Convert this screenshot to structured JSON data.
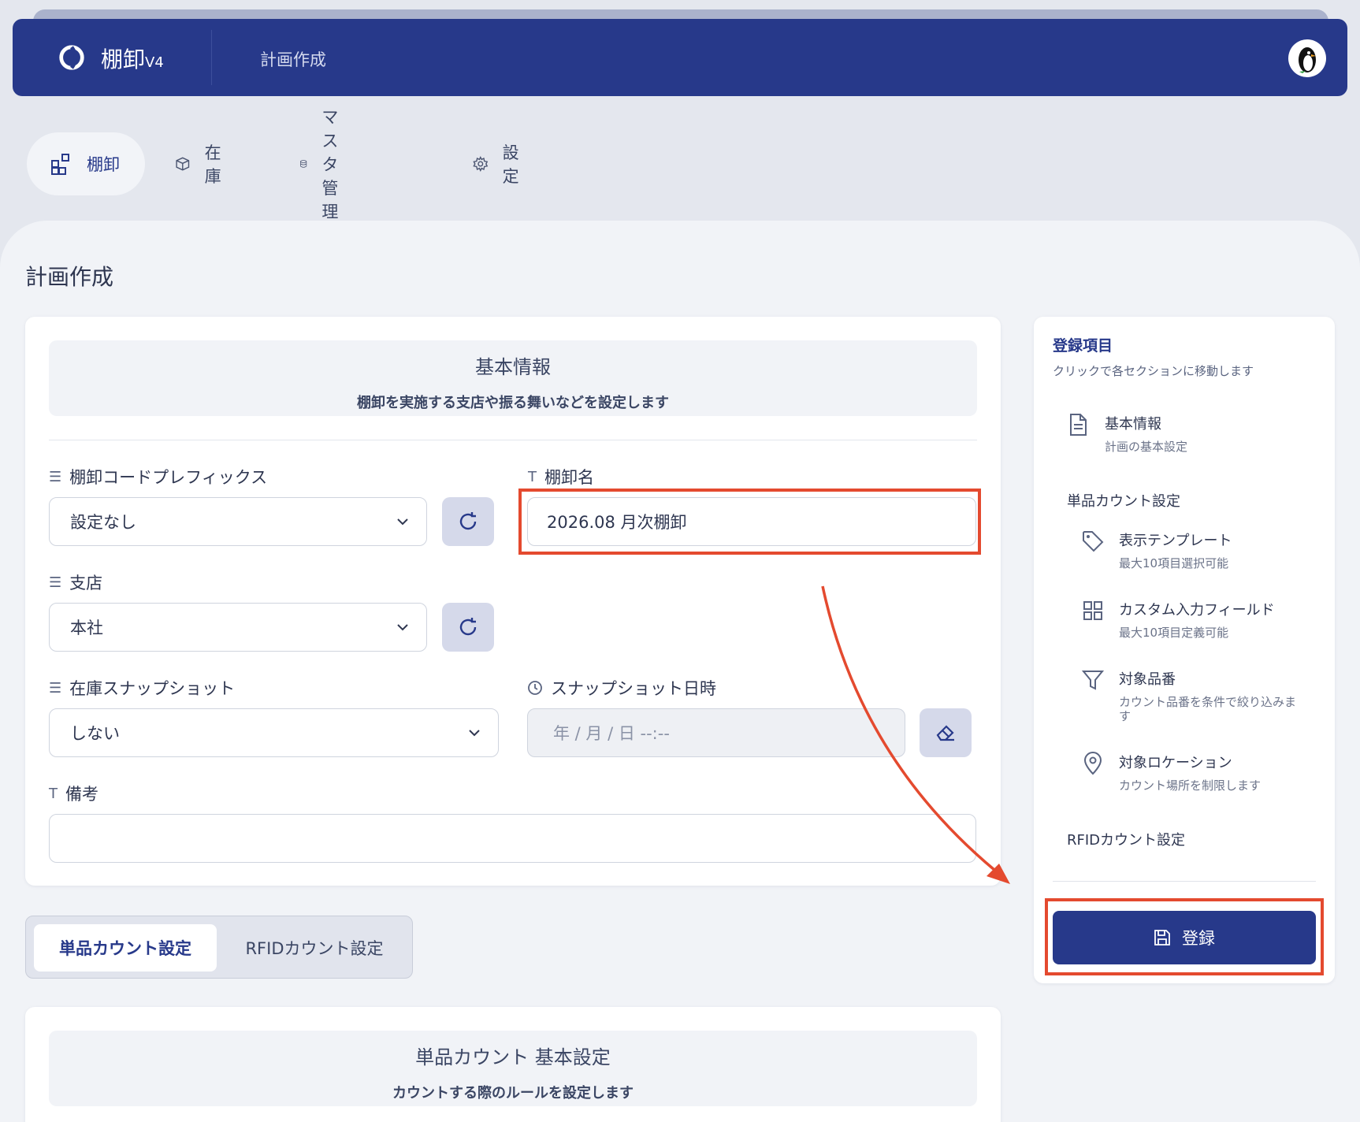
{
  "header": {
    "app_name": "棚卸",
    "app_version": "V4",
    "page": "計画作成"
  },
  "nav": {
    "items": [
      {
        "label": "棚卸",
        "icon": "grid-plus-icon"
      },
      {
        "label": "在庫",
        "icon": "box-icon"
      },
      {
        "label": "マスタ管理",
        "icon": "database-icon"
      },
      {
        "label": "設定",
        "icon": "gear-icon"
      }
    ]
  },
  "page_title": "計画作成",
  "basic_section": {
    "title": "基本情報",
    "subtitle": "棚卸を実施する支店や振る舞いなどを設定します"
  },
  "fields": {
    "prefix_label": "棚卸コードプレフィックス",
    "prefix_value": "設定なし",
    "name_label": "棚卸名",
    "name_value": "2026.08 月次棚卸",
    "branch_label": "支店",
    "branch_value": "本社",
    "snapshot_label": "在庫スナップショット",
    "snapshot_value": "しない",
    "snapshot_dt_label": "スナップショット日時",
    "snapshot_dt_placeholder": "年 / 月 / 日  --:--",
    "notes_label": "備考",
    "notes_value": ""
  },
  "tabs": {
    "single": "単品カウント設定",
    "rfid": "RFIDカウント設定"
  },
  "single_section": {
    "title": "単品カウント 基本設定",
    "subtitle": "カウントする際のルールを設定します"
  },
  "sidebar": {
    "title": "登録項目",
    "subtitle": "クリックで各セクションに移動します",
    "basic": {
      "label": "基本情報",
      "sub": "計画の基本設定"
    },
    "group_single": "単品カウント設定",
    "template": {
      "label": "表示テンプレート",
      "sub": "最大10項目選択可能"
    },
    "custom": {
      "label": "カスタム入力フィールド",
      "sub": "最大10項目定義可能"
    },
    "target_item": {
      "label": "対象品番",
      "sub": "カウント品番を条件で絞り込みます"
    },
    "target_loc": {
      "label": "対象ロケーション",
      "sub": "カウント場所を制限します"
    },
    "group_rfid": "RFIDカウント設定",
    "register": "登録"
  },
  "colors": {
    "primary": "#27398a",
    "annotation": "#e44a2f"
  }
}
